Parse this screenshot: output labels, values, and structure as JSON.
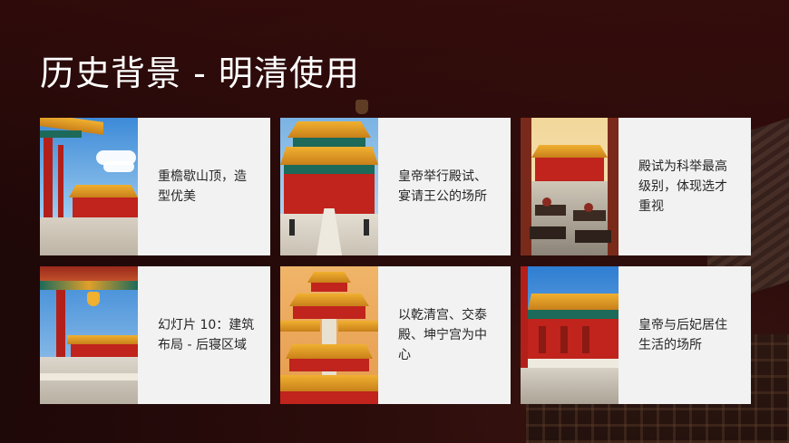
{
  "slide": {
    "title": "历史背景 - 明清使用"
  },
  "cards": [
    {
      "caption": "重檐歇山顶，造型优美",
      "image": "palace-eaves-sky-image"
    },
    {
      "caption": "皇帝举行殿试、宴请王公的场所",
      "image": "hall-front-staircase-image"
    },
    {
      "caption": "殿试为科举最高级别，体现选才重视",
      "image": "exam-hall-desks-image"
    },
    {
      "caption": "幻灯片 10：建筑布局 - 后寝区域",
      "image": "courtyard-corridor-image"
    },
    {
      "caption": "以乾清宫、交泰殿、坤宁宫为中心",
      "image": "aerial-palace-complex-image"
    },
    {
      "caption": "皇帝与后妃居住生活的场所",
      "image": "inner-courtyard-palace-image"
    }
  ],
  "colors": {
    "background": "#1f0808",
    "card": "#f2f2f2",
    "title": "#ffffff",
    "imperial_red": "#c0241c",
    "gold_roof": "#e0a02a"
  }
}
